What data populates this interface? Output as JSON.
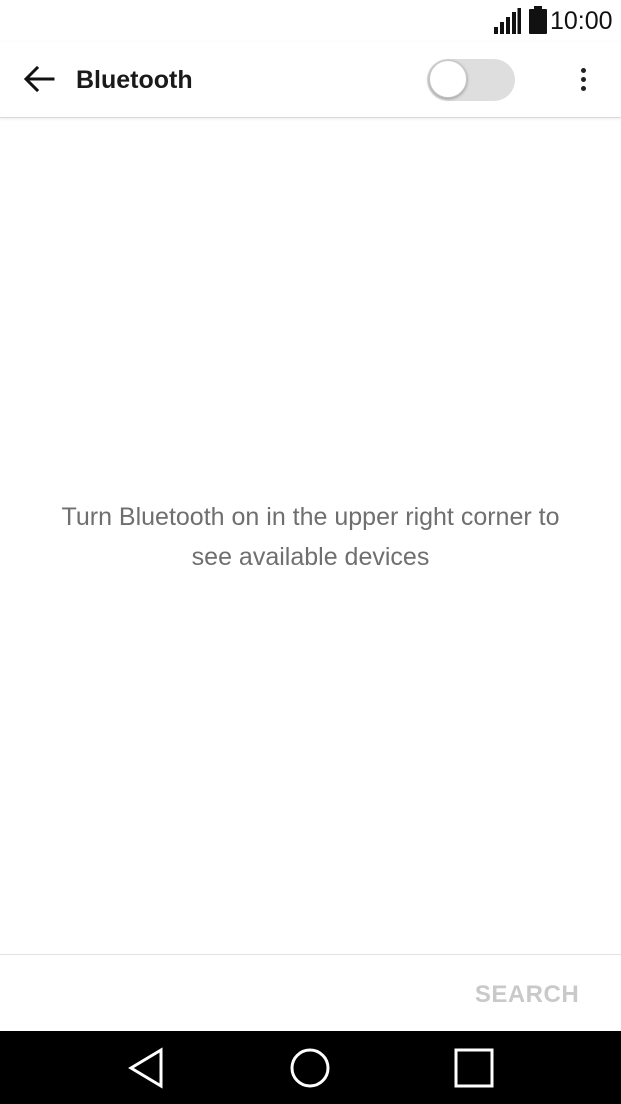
{
  "status_bar": {
    "time": "10:00",
    "icons": [
      "signal-icon",
      "battery-icon"
    ]
  },
  "app_bar": {
    "title": "Bluetooth",
    "back_icon": "arrow-left-icon",
    "menu_icon": "more-vert-icon",
    "bluetooth_enabled": false
  },
  "main": {
    "message_line1": "Turn Bluetooth on in the upper right corner to",
    "message_line2": "see available devices"
  },
  "actions": {
    "search_label": "SEARCH",
    "search_enabled": false
  },
  "nav_bar": {
    "icons": [
      "nav-back-icon",
      "nav-home-icon",
      "nav-recents-icon"
    ]
  },
  "colors": {
    "title_text": "#1a1a1a",
    "message_text": "#6f6f6f",
    "disabled_text": "#c9c9c9",
    "toggle_track_off": "#dedede",
    "nav_background": "#000000"
  }
}
